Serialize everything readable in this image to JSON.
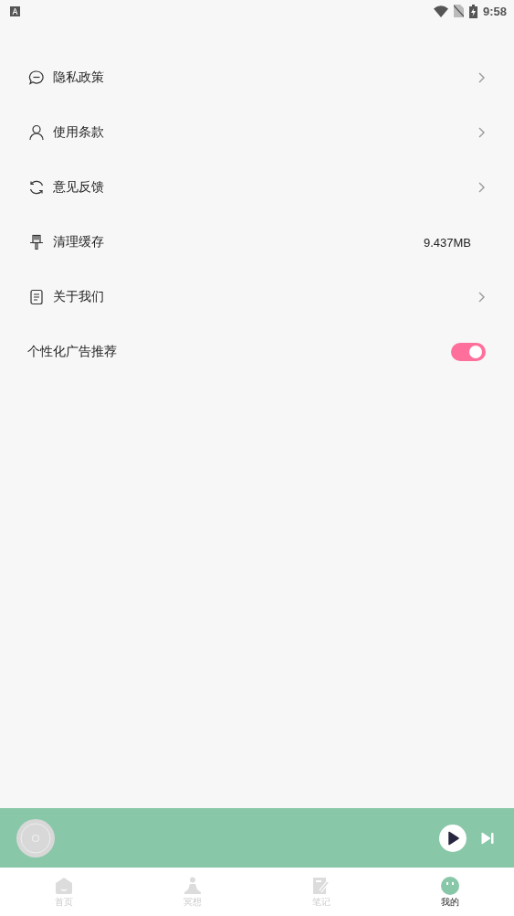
{
  "status_bar": {
    "time": "9:58"
  },
  "settings": [
    {
      "kind": "link",
      "label": "隐私政策"
    },
    {
      "kind": "link",
      "label": "使用条款"
    },
    {
      "kind": "link",
      "label": "意见反馈"
    },
    {
      "kind": "value",
      "label": "清理缓存",
      "value": "9.437MB"
    },
    {
      "kind": "link",
      "label": "关于我们"
    },
    {
      "kind": "toggle",
      "label": "个性化广告推荐",
      "on": true
    }
  ],
  "tab_bar": [
    {
      "label": "首页",
      "selected": false
    },
    {
      "label": "冥想",
      "selected": false
    },
    {
      "label": "笔记",
      "selected": false
    },
    {
      "label": "我的",
      "selected": true
    }
  ]
}
